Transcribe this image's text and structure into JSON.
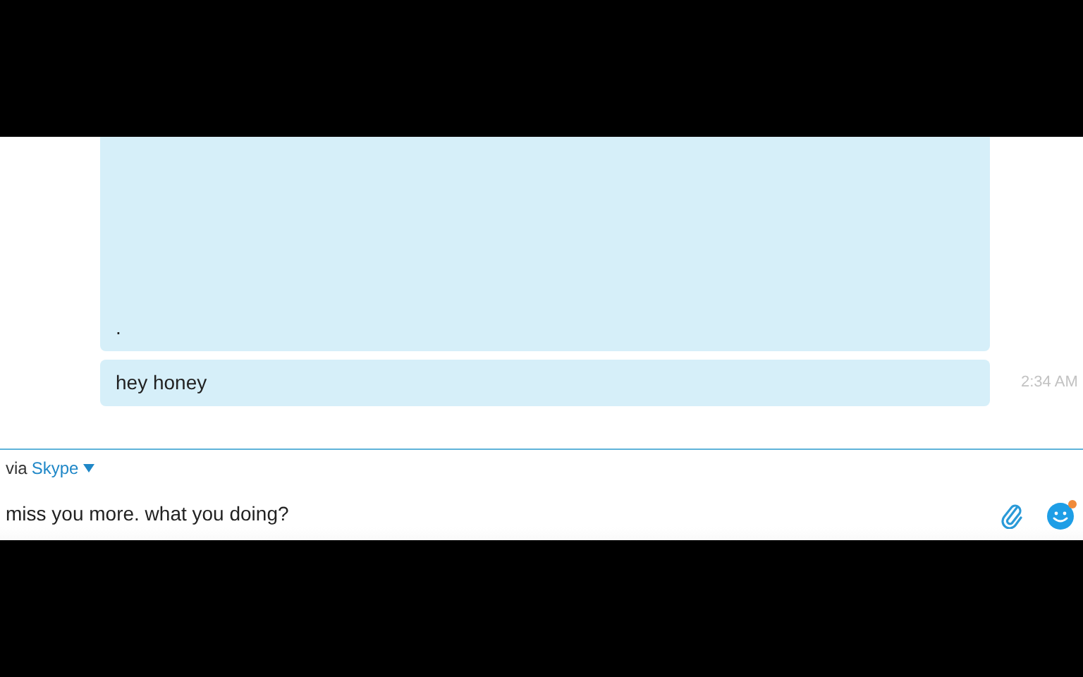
{
  "messages": [
    {
      "text": ".",
      "kind": "tall"
    },
    {
      "text": "hey honey",
      "time": "2:34 AM",
      "kind": "short"
    }
  ],
  "compose": {
    "via_label": "via",
    "service": "Skype",
    "value": "miss you more. what you doing?"
  }
}
